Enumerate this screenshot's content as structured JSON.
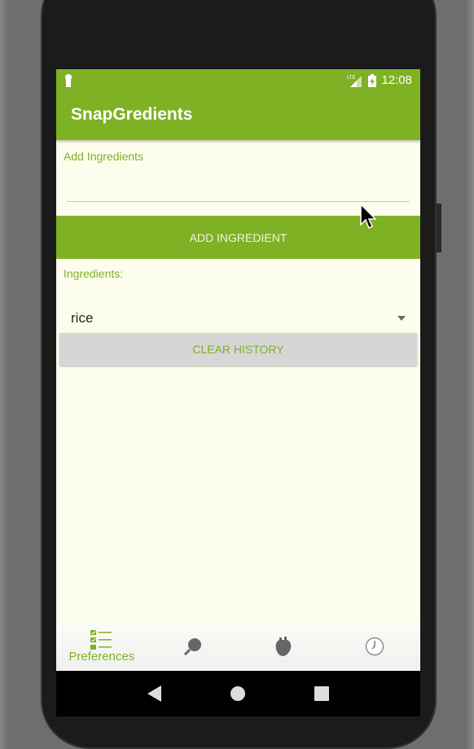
{
  "status_bar": {
    "time": "12:08",
    "network": "LTE"
  },
  "app_title": "SnapGredients",
  "add_section": {
    "label": "Add Ingredients",
    "input_value": "",
    "button": "ADD INGREDIENT"
  },
  "ingredients": {
    "label": "Ingredients:",
    "selected": "rice",
    "clear_button": "CLEAR HISTORY"
  },
  "bottom_nav": [
    {
      "label": "Preferences",
      "icon": "checklist-icon",
      "active": true
    },
    {
      "icon": "search-icon"
    },
    {
      "icon": "heart-icon"
    },
    {
      "icon": "clock-icon"
    }
  ],
  "colors": {
    "primary": "#7fb124",
    "background": "#fdfded"
  }
}
